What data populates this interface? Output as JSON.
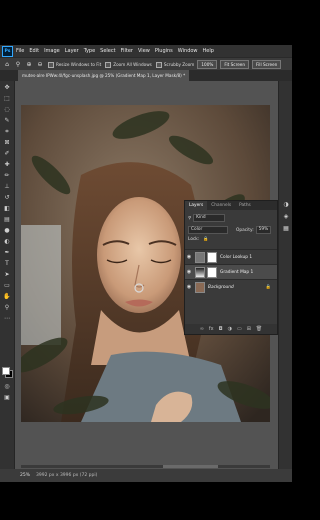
{
  "app": {
    "logo": "Ps",
    "menu": [
      "File",
      "Edit",
      "Image",
      "Layer",
      "Type",
      "Select",
      "Filter",
      "View",
      "Plugins",
      "Window",
      "Help"
    ]
  },
  "options": {
    "resize_label": "Resize Windows to Fit",
    "zoom_all_label": "Zoom All Windows",
    "scrubby_label": "Scrubby Zoom",
    "zoom_value": "100%",
    "fit_screen": "Fit Screen",
    "fill_screen": "Fill Screen"
  },
  "document": {
    "tab_title": "mutes-alre IPWw:4l/fgc-unsplash.jpg @ 25% (Gradient Map 1, Layer Mask/8) *",
    "zoom": "25%",
    "info": "3992 px x 3996 px (72 ppi)"
  },
  "layers_panel": {
    "tabs": [
      "Layers",
      "Channels",
      "Paths"
    ],
    "kind_label": "Kind",
    "blend_mode": "Color",
    "opacity_label": "Opacity:",
    "opacity_value": "59%",
    "lock_label": "Lock:",
    "layers": [
      {
        "name": "Color Lookup 1",
        "selected": false
      },
      {
        "name": "Gradient Map 1",
        "selected": true
      },
      {
        "name": "Background",
        "selected": false
      }
    ]
  },
  "icons": {
    "home": "home-icon",
    "zoom": "zoom-icon",
    "eye": "eye-icon",
    "lock": "lock-icon"
  },
  "colors": {
    "accent": "#31a8ff",
    "panel": "#3a3a3a",
    "workspace": "#535353"
  }
}
